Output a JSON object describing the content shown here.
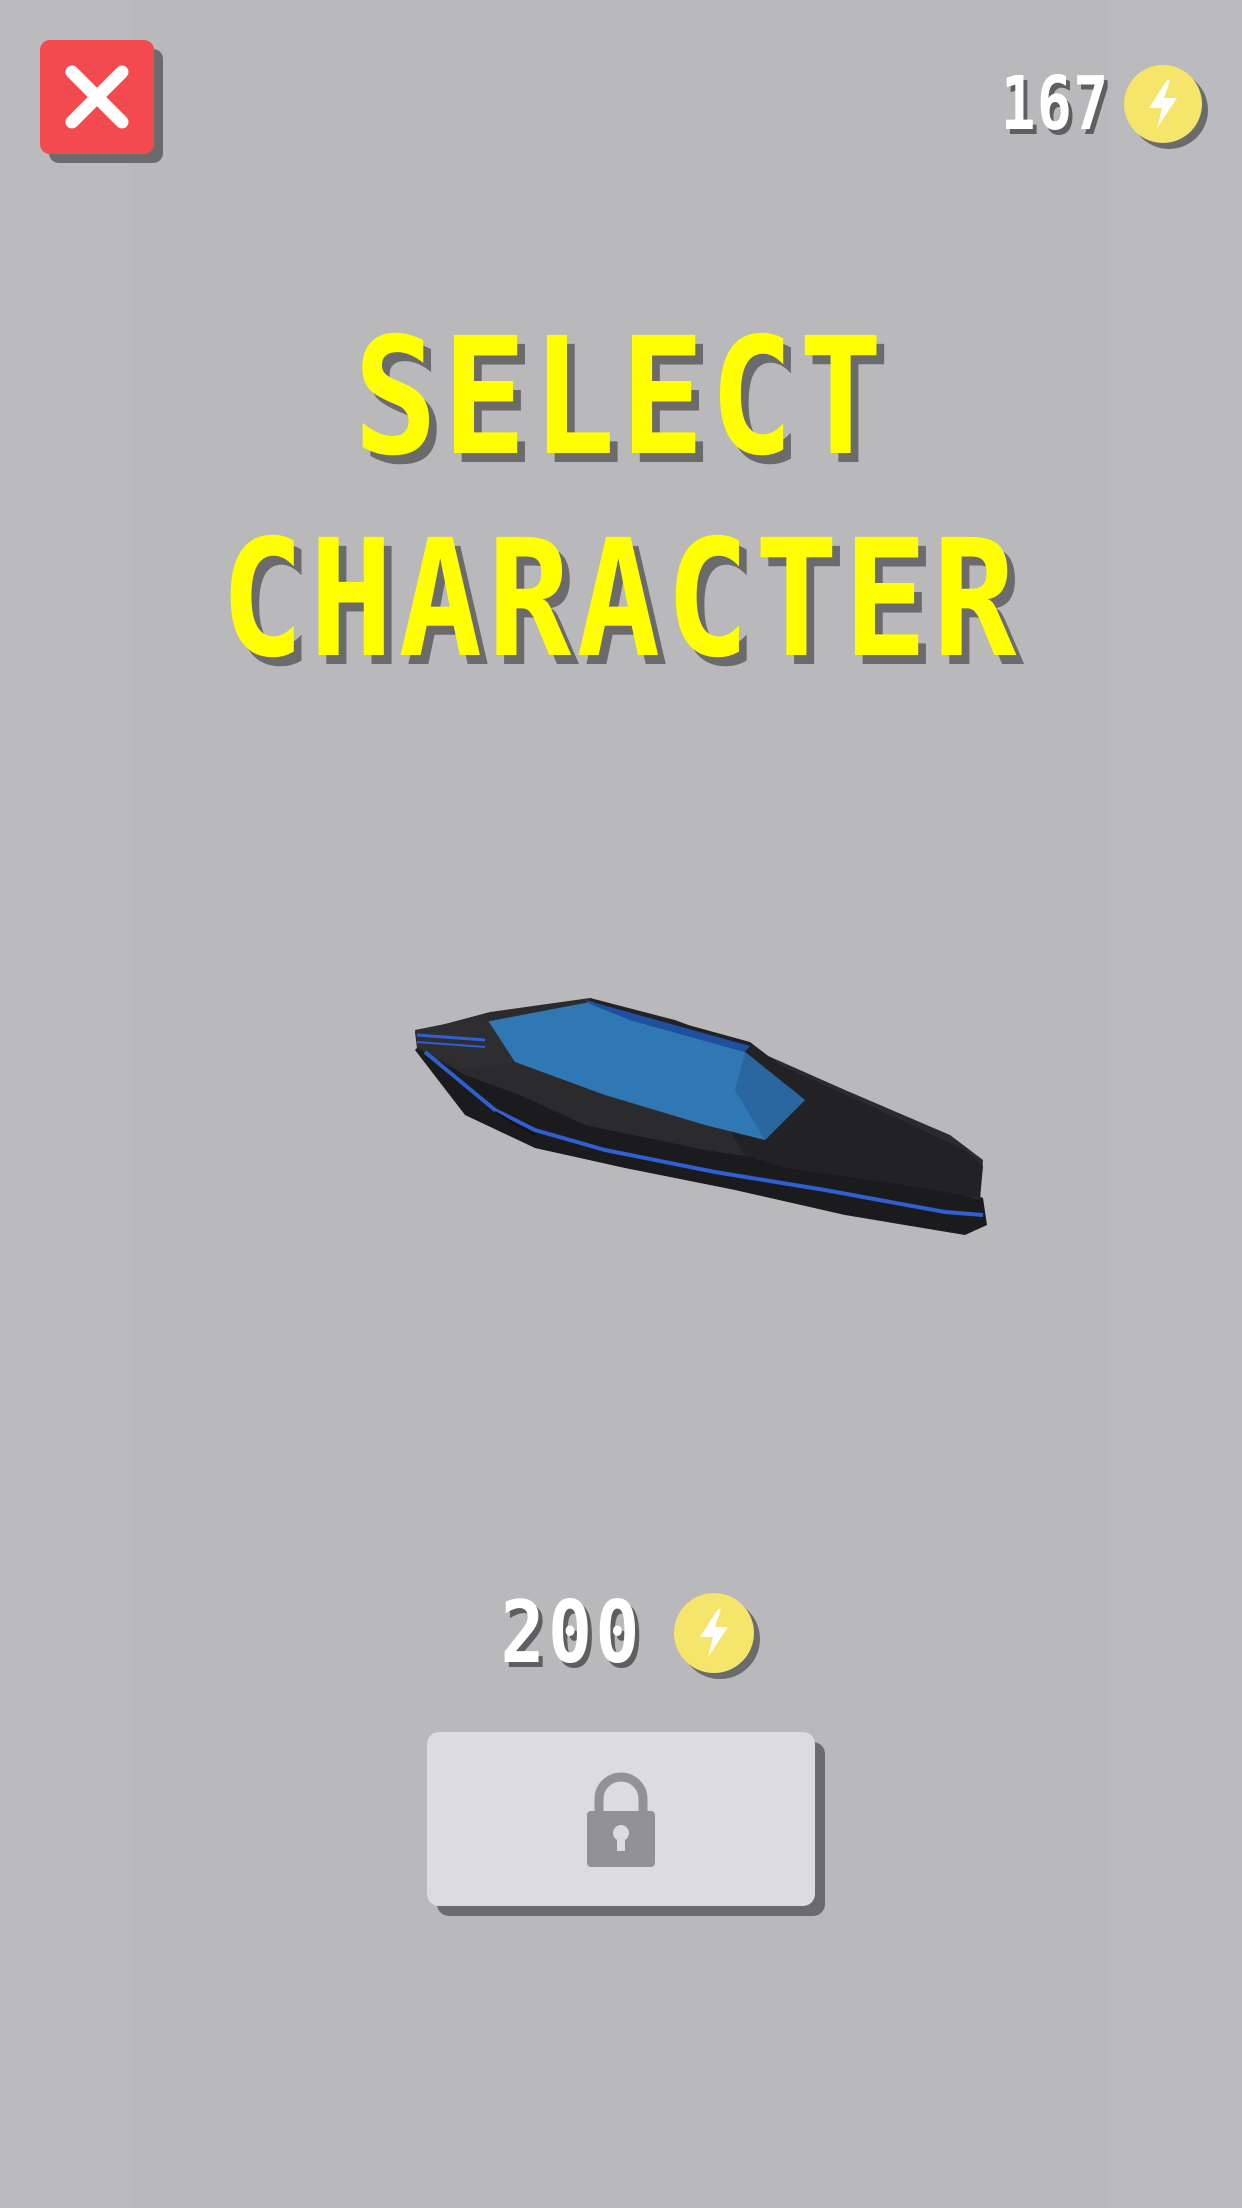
{
  "header": {
    "close_icon": "close-icon",
    "coin_count": "167",
    "coin_icon": "lightning-coin-icon"
  },
  "title": {
    "line1": "SELECT",
    "line2": "CHARACTER"
  },
  "character": {
    "icon": "spaceship-character"
  },
  "purchase": {
    "price": "200",
    "coin_icon": "lightning-coin-icon",
    "lock_icon": "lock-icon"
  },
  "colors": {
    "background": "#bbbabd",
    "close_button": "#f24a4f",
    "title": "#ffff00",
    "coin": "#f6e56b",
    "lock_button": "#dcdbdf",
    "ship_body": "#2a2a2c",
    "ship_accent": "#2f78b4"
  }
}
